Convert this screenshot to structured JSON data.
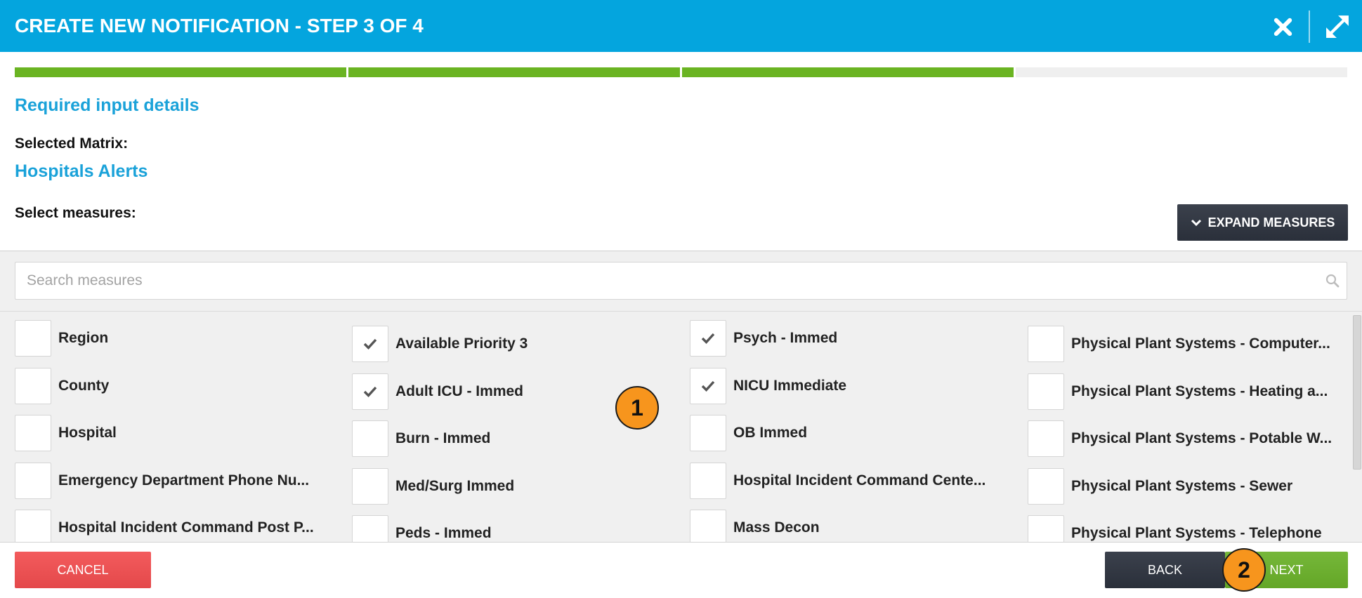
{
  "header": {
    "title": "CREATE NEW NOTIFICATION - STEP 3 OF 4",
    "close_icon": "close-icon",
    "expand_icon": "expand-icon"
  },
  "progress": {
    "completed_segments": 3,
    "total_segments": 4
  },
  "section_title": "Required input details",
  "selected_matrix": {
    "label": "Selected Matrix:",
    "value": "Hospitals Alerts"
  },
  "measures": {
    "label": "Select measures:",
    "expand_button": {
      "label": "EXPAND MEASURES",
      "icon": "chevron-down-icon"
    },
    "search": {
      "placeholder": "Search measures",
      "icon": "search-icon"
    },
    "scrollbar": {
      "position_fraction": 0,
      "visible_fraction": 0.68
    },
    "columns": [
      {
        "items": [
          {
            "label": "Region",
            "checked": false
          },
          {
            "label": "County",
            "checked": false
          },
          {
            "label": "Hospital",
            "checked": false
          },
          {
            "label": "Emergency Department Phone Nu...",
            "checked": false
          },
          {
            "label": "Hospital Incident Command Post P...",
            "checked": false
          }
        ]
      },
      {
        "items": [
          {
            "label": "Available Priority 3",
            "checked": true
          },
          {
            "label": "Adult ICU - Immed",
            "checked": true
          },
          {
            "label": "Burn - Immed",
            "checked": false
          },
          {
            "label": "Med/Surg Immed",
            "checked": false
          },
          {
            "label": "Peds - Immed",
            "checked": false
          }
        ]
      },
      {
        "items": [
          {
            "label": "Psych - Immed",
            "checked": true
          },
          {
            "label": "NICU Immediate",
            "checked": true
          },
          {
            "label": "OB Immed",
            "checked": false
          },
          {
            "label": "Hospital Incident Command Cente...",
            "checked": false
          },
          {
            "label": "Mass Decon",
            "checked": false
          }
        ]
      },
      {
        "items": [
          {
            "label": "Physical Plant Systems - Computer...",
            "checked": false
          },
          {
            "label": "Physical Plant Systems - Heating a...",
            "checked": false
          },
          {
            "label": "Physical Plant Systems - Potable W...",
            "checked": false
          },
          {
            "label": "Physical Plant Systems - Sewer",
            "checked": false
          },
          {
            "label": "Physical Plant Systems - Telephone",
            "checked": false
          }
        ]
      }
    ]
  },
  "annotations": [
    {
      "label": "1"
    },
    {
      "label": "2"
    }
  ],
  "footer": {
    "cancel_label": "CANCEL",
    "back_label": "BACK",
    "next_label": "NEXT"
  },
  "colors": {
    "header_bg": "#04a5de",
    "accent_text": "#1aa2d9",
    "progress_done": "#6ab422",
    "progress_pending": "#efefef",
    "cancel_button": "#f24d4f",
    "dark_button": "#2f3541",
    "next_button": "#6ab129",
    "annotation_marker": "#f7951d"
  }
}
